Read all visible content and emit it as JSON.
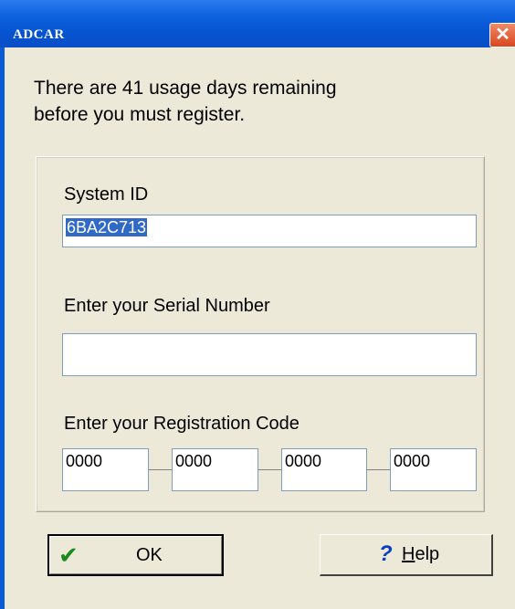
{
  "window": {
    "title": "ADCAR",
    "close_glyph": "✕"
  },
  "message": {
    "line1": "There are 41 usage days remaining",
    "line2": "before you must register."
  },
  "system_id": {
    "label": "System ID",
    "value": "6BA2C713"
  },
  "serial": {
    "label": "Enter your Serial Number",
    "value": ""
  },
  "registration": {
    "label": "Enter your Registration Code",
    "segments": [
      "0000",
      "0000",
      "0000",
      "0000"
    ]
  },
  "buttons": {
    "ok": {
      "label": "OK",
      "icon": "checkmark-icon",
      "icon_glyph": "✔",
      "icon_color": "#1a8a1a"
    },
    "help": {
      "label_mnemonic": "H",
      "label_rest": "elp",
      "icon": "question-icon",
      "icon_glyph": "?",
      "icon_color": "#0a3fc4"
    }
  }
}
